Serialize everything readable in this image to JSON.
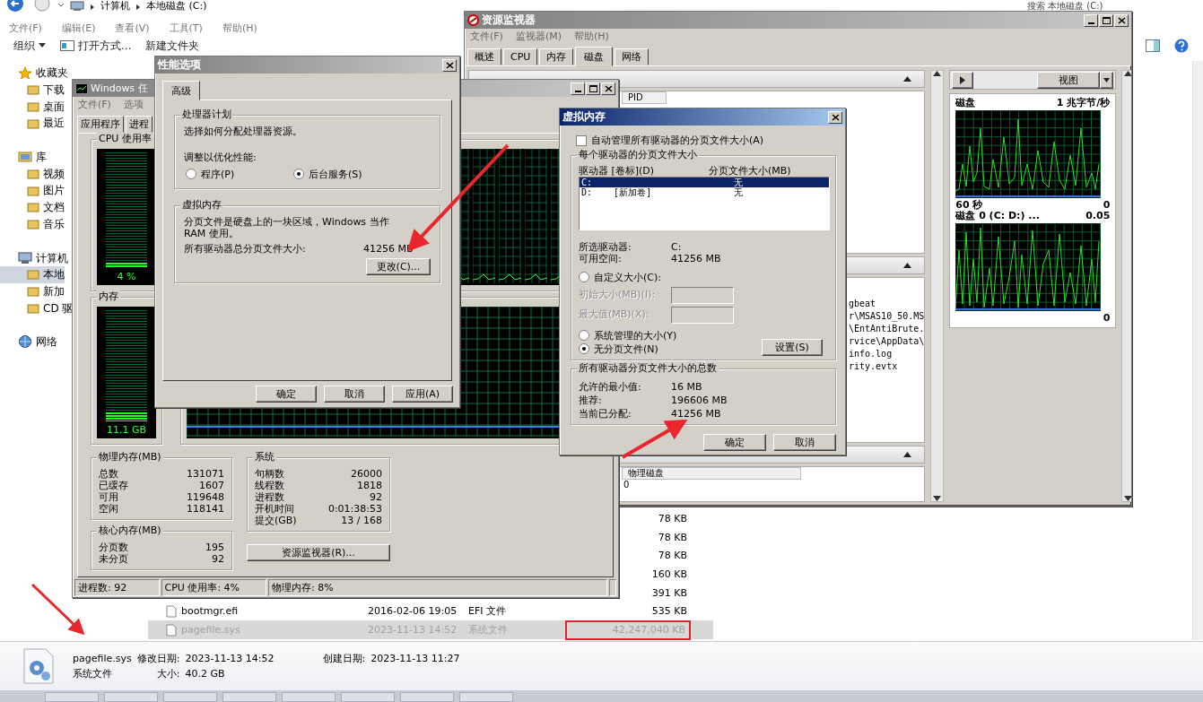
{
  "explorer": {
    "breadcrumb": [
      "计算机",
      "本地磁盘 (C:)"
    ],
    "search": {
      "placeholder": "搜索 本地磁盘 (C:)"
    },
    "menu": [
      "文件(F)",
      "编辑(E)",
      "查看(V)",
      "工具(T)",
      "帮助(H)"
    ],
    "toolbar": [
      "组织",
      "打开方式...",
      "新建文件夹"
    ],
    "sidebar": [
      {
        "label": "收藏夹",
        "selected": false,
        "children": [
          {
            "label": "下载",
            "selected": false
          },
          {
            "label": "桌面",
            "selected": false
          },
          {
            "label": "最近",
            "selected": false
          }
        ]
      },
      {
        "label": "库",
        "selected": false,
        "children": [
          {
            "label": "视频",
            "selected": false
          },
          {
            "label": "图片",
            "selected": false
          },
          {
            "label": "文档",
            "selected": false
          },
          {
            "label": "音乐",
            "selected": false
          }
        ]
      },
      {
        "label": "计算机",
        "selected": false,
        "children": [
          {
            "label": "本地",
            "selected": true
          },
          {
            "label": "新加",
            "selected": false
          },
          {
            "label": "CD 驱",
            "selected": false
          }
        ]
      },
      {
        "label": "网络",
        "selected": false
      }
    ],
    "files": [
      {
        "size": "78 KB",
        "selected": false
      },
      {
        "size": "78 KB",
        "selected": false
      },
      {
        "size": "78 KB",
        "selected": false
      },
      {
        "size": "160 KB",
        "selected": false
      },
      {
        "size": "391 KB",
        "selected": false
      },
      {
        "name": "bootmgr.efi",
        "modified": "2016-02-06 19:05",
        "type": "EFI 文件",
        "size": "535 KB",
        "selected": false
      },
      {
        "name": "pagefile.sys",
        "modified": "2023-11-13 14:52",
        "type": "系统文件",
        "size": "42,247,040 KB",
        "selected": true,
        "highlighted": true
      }
    ],
    "details": {
      "name": "pagefile.sys",
      "modified_label": "修改日期:",
      "modified": "2023-11-13 14:52",
      "created_label": "创建日期:",
      "created": "2023-11-13 11:27",
      "type": "系统文件",
      "size_label": "大小:",
      "size": "40.2 GB"
    }
  },
  "resource_monitor": {
    "title": "资源监视器",
    "menu": [
      "文件(F)",
      "监视器(M)",
      "帮助(H)"
    ],
    "tabs": [
      {
        "label": "概述",
        "selected": false
      },
      {
        "label": "CPU",
        "selected": false
      },
      {
        "label": "内存",
        "selected": false
      },
      {
        "label": "磁盘",
        "selected": true
      },
      {
        "label": "网络",
        "selected": false
      }
    ],
    "process_columns": [
      "PID"
    ],
    "file_lines": [
      "gbeat",
      "r\\MSAS10_50.MS",
      "\\EntAntiBrute.",
      "rvice\\AppData\\",
      "info.log",
      "rity.evtx"
    ],
    "storage": {
      "columns": [
        "物理磁盘"
      ],
      "rows": [
        "0"
      ]
    },
    "view_button": "视图",
    "graphs": [
      {
        "title": "磁盘",
        "scale": "1 兆字节/秒",
        "time": "60 秒",
        "min": "0"
      },
      {
        "title": "磁盘 0 (C: D:) ...",
        "scale": "0.05",
        "min": "0"
      }
    ]
  },
  "task_manager": {
    "title": "Windows 任",
    "menu": [
      "文件(F)",
      "选项"
    ],
    "tabs": [
      {
        "label": "应用程序",
        "selected": false
      },
      {
        "label": "进程",
        "selected": false
      }
    ],
    "cpu": {
      "title": "CPU 使用率",
      "level": 0.04,
      "reading": "4 %"
    },
    "memory": {
      "title": "内存",
      "level": 0.085,
      "reading": "11.1 GB"
    },
    "physical_memory": {
      "title": "物理内存(MB)",
      "rows": [
        {
          "label": "总数",
          "value": "131071"
        },
        {
          "label": "已缓存",
          "value": "1607"
        },
        {
          "label": "可用",
          "value": "119648"
        },
        {
          "label": "空闲",
          "value": "118141"
        }
      ]
    },
    "kernel_memory": {
      "title": "核心内存(MB)",
      "rows": [
        {
          "label": "分页数",
          "value": "195"
        },
        {
          "label": "未分页",
          "value": "92"
        }
      ]
    },
    "system": {
      "title": "系统",
      "rows": [
        {
          "label": "句柄数",
          "value": "26000"
        },
        {
          "label": "线程数",
          "value": "1818"
        },
        {
          "label": "进程数",
          "value": "92"
        },
        {
          "label": "开机时间",
          "value": "0:01:38:53"
        },
        {
          "label": "提交(GB)",
          "value": "13 / 168"
        }
      ]
    },
    "resource_monitor_button": "资源监视器(R)...",
    "status_bar": [
      "进程数: 92",
      "CPU 使用率: 4%",
      "物理内存: 8%"
    ]
  },
  "performance_options": {
    "title": "性能选项",
    "tabs": [
      {
        "label": "高级",
        "selected": true
      }
    ],
    "processor": {
      "title": "处理器计划",
      "description": "选择如何分配处理器资源。",
      "prompt": "调整以优化性能:",
      "options": [
        {
          "label": "程序(P)",
          "selected": false
        },
        {
          "label": "后台服务(S)",
          "selected": true
        }
      ]
    },
    "virtual_memory": {
      "title": "虚拟内存",
      "description": "分页文件是硬盘上的一块区域，Windows 当作 RAM 使用。",
      "total_label": "所有驱动器总分页文件大小:",
      "total": "41256 MB",
      "button": "更改(C)..."
    },
    "buttons": [
      "确定",
      "取消",
      "应用(A)"
    ]
  },
  "virtual_memory": {
    "title": "虚拟内存",
    "auto_manage": {
      "label": "自动管理所有驱动器的分页文件大小(A)",
      "checked": false
    },
    "per_drive": {
      "title": "每个驱动器的分页文件大小",
      "columns": [
        "驱动器 [卷标](D)",
        "分页文件大小(MB)"
      ],
      "drives": [
        {
          "drive": "C:",
          "size": "无",
          "selected": true
        },
        {
          "drive": "D:",
          "label": "[新加卷]",
          "size": "无",
          "selected": false
        }
      ],
      "selected_drive_label": "所选驱动器:",
      "selected_drive": "C:",
      "free_label": "可用空间:",
      "free": "41256 MB",
      "custom": {
        "label": "自定义大小(C):",
        "selected": false
      },
      "fields": [
        {
          "label": "初始大小(MB)(I):",
          "disabled": true
        },
        {
          "label": "最大值(MB)(X):",
          "disabled": true
        }
      ],
      "options": [
        {
          "label": "系统管理的大小(Y)",
          "selected": false
        },
        {
          "label": "无分页文件(N)",
          "selected": true
        }
      ],
      "set_button": "设置(S)"
    },
    "totals": {
      "title": "所有驱动器分页文件大小的总数",
      "rows": [
        {
          "label": "允许的最小值:",
          "value": "16 MB"
        },
        {
          "label": "推荐:",
          "value": "196606 MB"
        },
        {
          "label": "当前已分配:",
          "value": "41256 MB"
        }
      ]
    },
    "buttons": [
      "确定",
      "取消"
    ]
  }
}
